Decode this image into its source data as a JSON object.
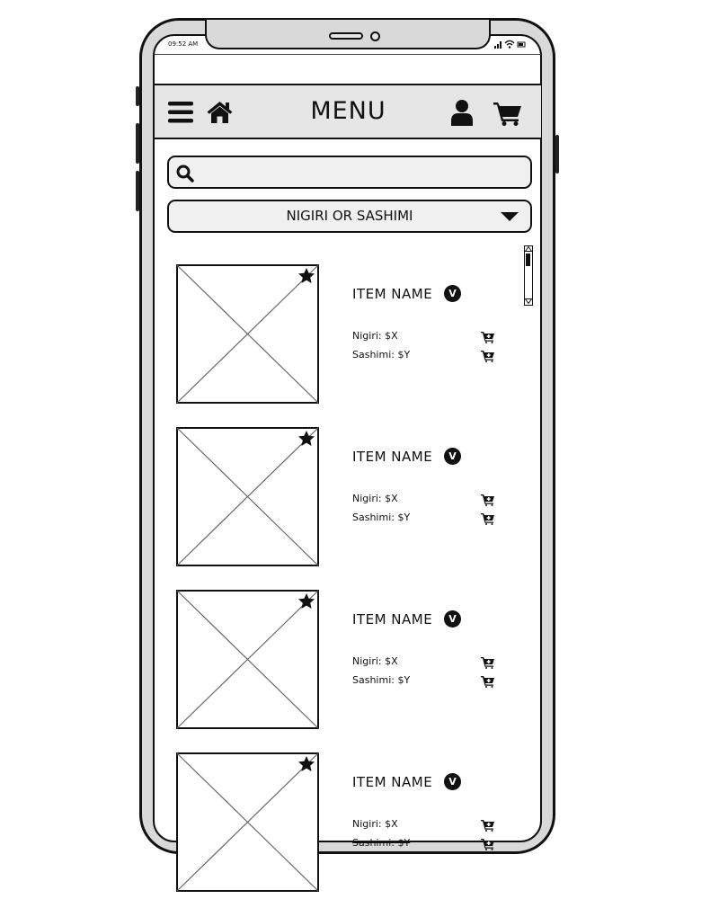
{
  "status_bar": {
    "time": "09:52 AM"
  },
  "header": {
    "title": "MENU",
    "icons": [
      "hamburger-menu-icon",
      "home-icon",
      "user-icon",
      "cart-icon"
    ]
  },
  "search": {
    "placeholder": "",
    "value": ""
  },
  "filter": {
    "selected": "NIGIRI OR SASHIMI"
  },
  "items": [
    {
      "name": "ITEM NAME",
      "badge": "V",
      "nigiri": "Nigiri: $X",
      "sashimi": "Sashimi: $Y"
    },
    {
      "name": "ITEM NAME",
      "badge": "V",
      "nigiri": "Nigiri: $X",
      "sashimi": "Sashimi: $Y"
    },
    {
      "name": "ITEM NAME",
      "badge": "V",
      "nigiri": "Nigiri: $X",
      "sashimi": "Sashimi: $Y"
    },
    {
      "name": "ITEM NAME",
      "badge": "V",
      "nigiri": "Nigiri: $X",
      "sashimi": "Sashimi: $Y"
    }
  ],
  "colors": {
    "header_bg": "#e6e6e6",
    "ink": "#111111",
    "device": "#d9d9d9"
  }
}
